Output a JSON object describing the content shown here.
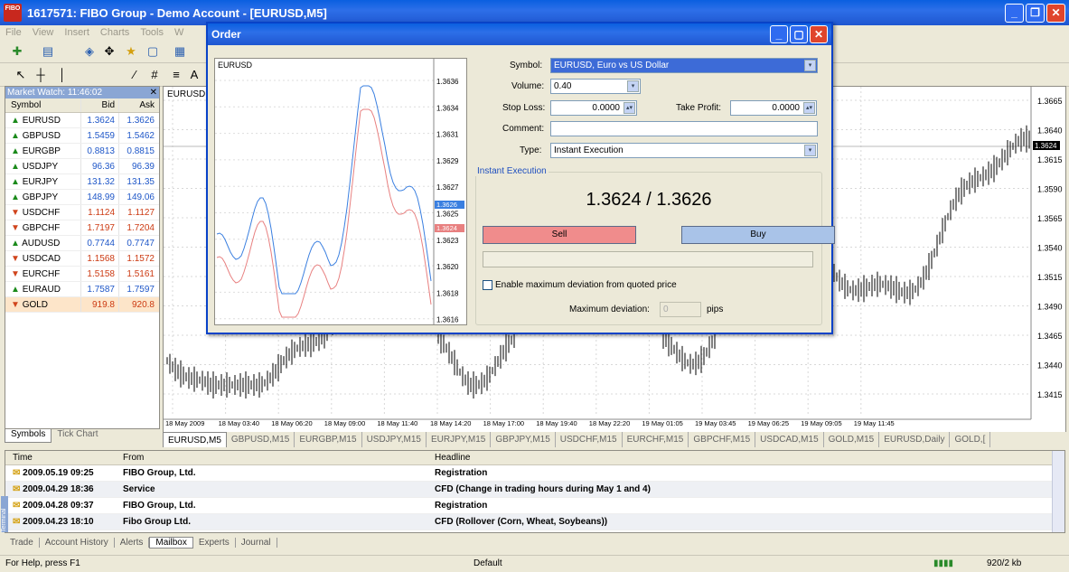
{
  "title": "1617571: FIBO Group - Demo Account - [EURUSD,M5]",
  "logo": "FIBO",
  "menu": [
    "File",
    "View",
    "Insert",
    "Charts",
    "Tools",
    "W"
  ],
  "toolbar2_a": "A",
  "market_watch": {
    "title": "Market Watch: 11:46:02",
    "cols": [
      "Symbol",
      "Bid",
      "Ask"
    ],
    "rows": [
      {
        "s": "EURUSD",
        "b": "1.3624",
        "a": "1.3626",
        "d": "up"
      },
      {
        "s": "GBPUSD",
        "b": "1.5459",
        "a": "1.5462",
        "d": "up"
      },
      {
        "s": "EURGBP",
        "b": "0.8813",
        "a": "0.8815",
        "d": "up"
      },
      {
        "s": "USDJPY",
        "b": "96.36",
        "a": "96.39",
        "d": "up"
      },
      {
        "s": "EURJPY",
        "b": "131.32",
        "a": "131.35",
        "d": "up"
      },
      {
        "s": "GBPJPY",
        "b": "148.99",
        "a": "149.06",
        "d": "up"
      },
      {
        "s": "USDCHF",
        "b": "1.1124",
        "a": "1.1127",
        "d": "dn"
      },
      {
        "s": "GBPCHF",
        "b": "1.7197",
        "a": "1.7204",
        "d": "dn"
      },
      {
        "s": "AUDUSD",
        "b": "0.7744",
        "a": "0.7747",
        "d": "up"
      },
      {
        "s": "USDCAD",
        "b": "1.1568",
        "a": "1.1572",
        "d": "dn"
      },
      {
        "s": "EURCHF",
        "b": "1.5158",
        "a": "1.5161",
        "d": "dn"
      },
      {
        "s": "EURAUD",
        "b": "1.7587",
        "a": "1.7597",
        "d": "up"
      },
      {
        "s": "GOLD",
        "b": "919.8",
        "a": "920.8",
        "d": "dn"
      }
    ],
    "tabs": [
      "Symbols",
      "Tick Chart"
    ]
  },
  "chart": {
    "label": "EURUSD,M",
    "y_ticks": [
      "1.3665",
      "1.3640",
      "1.3615",
      "1.3590",
      "1.3565",
      "1.3540",
      "1.3515",
      "1.3490",
      "1.3465",
      "1.3440",
      "1.3415"
    ],
    "current": "1.3624",
    "x_ticks": [
      "18 May 2009",
      "18 May 03:40",
      "18 May 06:20",
      "18 May 09:00",
      "18 May 11:40",
      "18 May 14:20",
      "18 May 17:00",
      "18 May 19:40",
      "18 May 22:20",
      "19 May 01:05",
      "19 May 03:45",
      "19 May 06:25",
      "19 May 09:05",
      "19 May 11:45"
    ]
  },
  "chart_tabs": [
    "EURUSD,M5",
    "GBPUSD,M15",
    "EURGBP,M15",
    "USDJPY,M15",
    "EURJPY,M15",
    "GBPJPY,M15",
    "USDCHF,M15",
    "EURCHF,M15",
    "GBPCHF,M15",
    "USDCAD,M15",
    "GOLD,M15",
    "EURUSD,Daily",
    "GOLD,["
  ],
  "terminal": {
    "cols": [
      "Time",
      "From",
      "Headline"
    ],
    "side_label": "Terminal",
    "rows": [
      {
        "t": "2009.05.19 09:25",
        "f": "FIBO Group, Ltd.",
        "h": "Registration"
      },
      {
        "t": "2009.04.29 18:36",
        "f": "Service",
        "h": "CFD (Change in trading hours during May 1 and 4)"
      },
      {
        "t": "2009.04.28 09:37",
        "f": "FIBO Group, Ltd.",
        "h": "Registration"
      },
      {
        "t": "2009.04.23 18:10",
        "f": "Fibo Group Ltd.",
        "h": "CFD (Rollover (Corn, Wheat, Soybeans))"
      }
    ],
    "tabs": [
      "Trade",
      "Account History",
      "Alerts",
      "Mailbox",
      "Experts",
      "Journal"
    ]
  },
  "status": {
    "help": "For Help, press F1",
    "profile": "Default",
    "traffic": "920/2 kb"
  },
  "order": {
    "title": "Order",
    "mini_label": "EURUSD",
    "mini_ticks": [
      "1.3636",
      "1.3634",
      "1.3631",
      "1.3629",
      "1.3627",
      "1.3625",
      "1.3623",
      "1.3620",
      "1.3618",
      "1.3616"
    ],
    "mini_ask": "1.3626",
    "mini_bid": "1.3624",
    "symbol_label": "Symbol:",
    "symbol": "EURUSD, Euro vs US Dollar",
    "volume_label": "Volume:",
    "volume": "0.40",
    "sl_label": "Stop Loss:",
    "sl": "0.0000",
    "tp_label": "Take Profit:",
    "tp": "0.0000",
    "comment_label": "Comment:",
    "comment": "",
    "type_label": "Type:",
    "type": "Instant Execution",
    "group": "Instant Execution",
    "quote": "1.3624 / 1.3626",
    "sell": "Sell",
    "buy": "Buy",
    "deviation_check": "Enable maximum deviation from quoted price",
    "deviation_label": "Maximum deviation:",
    "deviation": "0",
    "pips": "pips"
  }
}
